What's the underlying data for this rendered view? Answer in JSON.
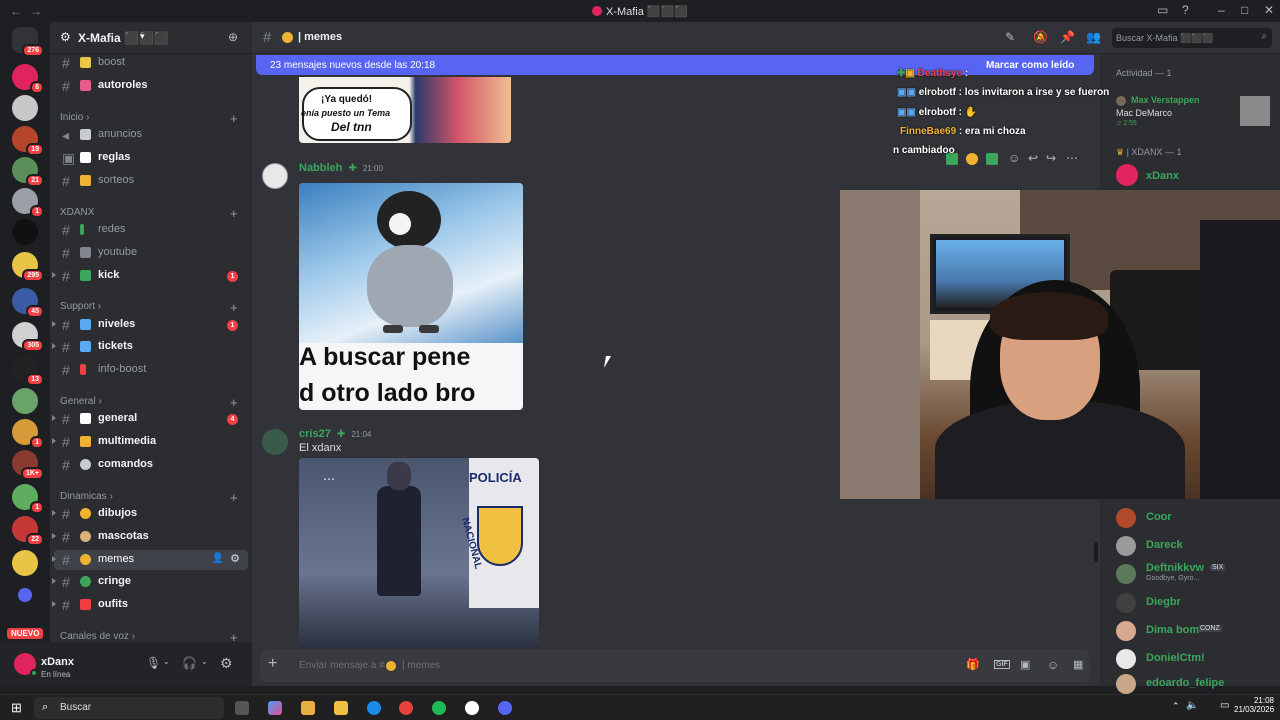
{
  "app": {
    "title": "X-Mafia ⬛⬛⬛"
  },
  "server": {
    "name": "X-Mafia ⬛⬛⬛",
    "badges": [
      "276",
      "6",
      "19",
      "21",
      "1",
      "295",
      "45",
      "305",
      "13",
      "1",
      "1",
      "1K+",
      "1",
      "22"
    ],
    "nuevo_label": "NUEVO"
  },
  "categories": [
    {
      "name": "Inicio"
    },
    {
      "name": "XDANX"
    },
    {
      "name": "Support"
    },
    {
      "name": "General"
    },
    {
      "name": "Dinamicas"
    },
    {
      "name": "Canales de voz"
    }
  ],
  "channels": [
    {
      "label": "boost",
      "emoji": "#e8c547"
    },
    {
      "label": "autoroles",
      "emoji": "#e85b8a"
    },
    {
      "label": "anuncios",
      "emoji": "#c8ccd1"
    },
    {
      "label": "reglas",
      "emoji": "#ffffff"
    },
    {
      "label": "sorteos",
      "emoji": "#f0b232"
    },
    {
      "label": "redes",
      "emoji": "#3ba55c"
    },
    {
      "label": "youtube",
      "emoji": "#80848e"
    },
    {
      "label": "kick",
      "emoji": "#3ba55c",
      "badge": "1"
    },
    {
      "label": "niveles",
      "emoji": "#5aa9f2",
      "badge": "1"
    },
    {
      "label": "tickets",
      "emoji": "#5aa9f2"
    },
    {
      "label": "info-boost",
      "emoji": "#f23f43"
    },
    {
      "label": "general",
      "emoji": "#ffffff",
      "badge": "4"
    },
    {
      "label": "multimedia",
      "emoji": "#f0b232"
    },
    {
      "label": "comandos",
      "emoji": "#c8ccd1"
    },
    {
      "label": "dibujos",
      "emoji": "#f0b232"
    },
    {
      "label": "mascotas",
      "emoji": "#d7b27a"
    },
    {
      "label": "memes",
      "emoji": "#f0b232"
    },
    {
      "label": "cringe",
      "emoji": "#3ba55c"
    },
    {
      "label": "oufits",
      "emoji": "#f23f43"
    }
  ],
  "channel_header": {
    "name": "memes",
    "search_placeholder": "Buscar X-Mafia ⬛⬛⬛"
  },
  "banner": {
    "text": "23 mensajes nuevos desde las 20:18",
    "action": "Marcar como leído"
  },
  "messages": [
    {
      "author": "Nabbleh",
      "time": "21:00",
      "image_caption_top": "¡Ya quedó!",
      "image_caption_mid": "enía puesto un Tema",
      "image_caption_bottom": "Del tnn",
      "meme_text_1": "A buscar pene",
      "meme_text_2": "d otro lado bro"
    },
    {
      "author": "cris27",
      "time": "21:04",
      "text": "El xdanx",
      "police_text": "POLICÍA",
      "nacional_text": "NACIONAL"
    }
  ],
  "composer": {
    "placeholder": "Enviar mensaje a #",
    "channel": "memes"
  },
  "user": {
    "name": "xDanx",
    "status": "En línea"
  },
  "chat_overlay": [
    {
      "user": "Deathsye",
      "text": ""
    },
    {
      "user": "elrobotf",
      "text": "los invitaron a irse y se fueron"
    },
    {
      "user": "elrobotf",
      "text": "era ⬛"
    },
    {
      "user": "FinneBae69",
      "text": "era mi choza"
    },
    {
      "user": "",
      "text": "n cambiadoo"
    }
  ],
  "members": {
    "activity_header": "Actividad — 1",
    "spotify_user": "Max Verstappen",
    "spotify_track": "Mac DeMarco",
    "spotify_time": "2:55",
    "role_header": "| XDANX — 1",
    "role_member": "xDanx",
    "list": [
      {
        "name": "Coor",
        "color": "#3ba55c"
      },
      {
        "name": "Dareck",
        "color": "#3ba55c"
      },
      {
        "name": "Deftnikkvw",
        "color": "#3ba55c",
        "tag": "SIX",
        "sub": "Goodbye, Gyro..."
      },
      {
        "name": "Diegbr",
        "color": "#3ba55c"
      },
      {
        "name": "Dima bom",
        "color": "#3ba55c",
        "tag": "CONZ"
      },
      {
        "name": "DonielCtm!",
        "color": "#3ba55c"
      },
      {
        "name": "edoardo_felipe",
        "color": "#3ba55c"
      }
    ]
  },
  "taskbar": {
    "search": "Buscar",
    "time": "21:08",
    "date": "21/03/2026"
  }
}
